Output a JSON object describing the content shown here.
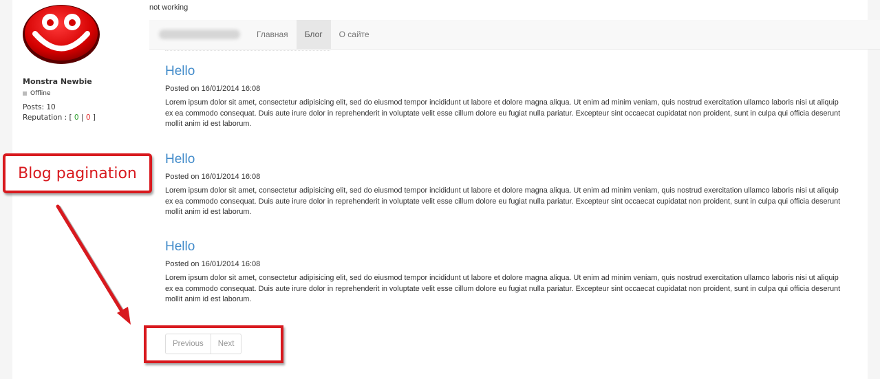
{
  "sidebar": {
    "username": "Monstra Newbie",
    "status": "Offline",
    "posts": "Posts: 10",
    "reputation_prefix": "Reputation : [ ",
    "reputation_positive": "0",
    "reputation_separator": " | ",
    "reputation_negative": "0",
    "reputation_suffix": " ]"
  },
  "topic": {
    "title": "not working"
  },
  "navbar": {
    "items": [
      {
        "label": "Главная",
        "active": false
      },
      {
        "label": "Блог",
        "active": true
      },
      {
        "label": "О сайте",
        "active": false
      }
    ]
  },
  "posts": [
    {
      "title": "Hello",
      "date": "Posted on 16/01/2014 16:08",
      "body": "Lorem ipsum dolor sit amet, consectetur adipisicing elit, sed do eiusmod tempor incididunt ut labore et dolore magna aliqua. Ut enim ad minim veniam, quis nostrud exercitation ullamco laboris nisi ut aliquip ex ea commodo consequat. Duis aute irure dolor in reprehenderit in voluptate velit esse cillum dolore eu fugiat nulla pariatur. Excepteur sint occaecat cupidatat non proident, sunt in culpa qui officia deserunt mollit anim id est laborum."
    },
    {
      "title": "Hello",
      "date": "Posted on 16/01/2014 16:08",
      "body": "Lorem ipsum dolor sit amet, consectetur adipisicing elit, sed do eiusmod tempor incididunt ut labore et dolore magna aliqua. Ut enim ad minim veniam, quis nostrud exercitation ullamco laboris nisi ut aliquip ex ea commodo consequat. Duis aute irure dolor in reprehenderit in voluptate velit esse cillum dolore eu fugiat nulla pariatur. Excepteur sint occaecat cupidatat non proident, sunt in culpa qui officia deserunt mollit anim id est laborum."
    },
    {
      "title": "Hello",
      "date": "Posted on 16/01/2014 16:08",
      "body": "Lorem ipsum dolor sit amet, consectetur adipisicing elit, sed do eiusmod tempor incididunt ut labore et dolore magna aliqua. Ut enim ad minim veniam, quis nostrud exercitation ullamco laboris nisi ut aliquip ex ea commodo consequat. Duis aute irure dolor in reprehenderit in voluptate velit esse cillum dolore eu fugiat nulla pariatur. Excepteur sint occaecat cupidatat non proident, sunt in culpa qui officia deserunt mollit anim id est laborum."
    }
  ],
  "pagination": {
    "previous": "Previous",
    "next": "Next"
  },
  "annotation": {
    "callout": "Blog pagination"
  },
  "colors": {
    "link": "#428bca",
    "annotation": "#d8191e",
    "avatar": "#e01010",
    "rep_positive": "#2e9e2e",
    "rep_negative": "#e02a2a"
  },
  "icons": {
    "avatar": "red-smiley-face-icon",
    "arrow": "red-arrow-icon"
  }
}
